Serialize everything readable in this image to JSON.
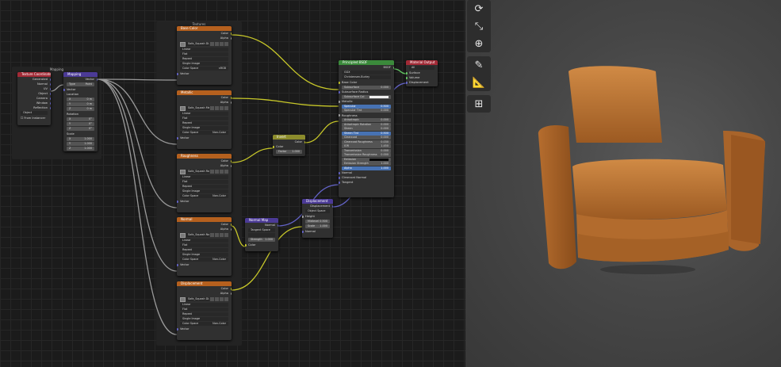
{
  "editor": {
    "frames": {
      "textures": "Textures",
      "mapping": "Mapping"
    },
    "texcoord": {
      "title": "Texture Coordinate",
      "outputs": [
        "Generated",
        "Normal",
        "UV",
        "Object",
        "Camera",
        "Window",
        "Reflection"
      ],
      "object_label": "Object",
      "from_instancer": "From Instancer"
    },
    "mapping": {
      "title": "Mapping",
      "output": "Vector",
      "type_label": "Type",
      "type_value": "Point",
      "vector": "Vector",
      "location": "Location",
      "rotation": "Rotation",
      "scale": "Scale",
      "axes": [
        "X",
        "Y",
        "Z"
      ],
      "loc_values": [
        "0 m",
        "0 m",
        "0 m"
      ],
      "rot_values": [
        "0°",
        "0°",
        "0°"
      ],
      "scale_values": [
        "1.000",
        "1.000",
        "1.000"
      ]
    },
    "image_nodes": [
      {
        "title": "Base Color",
        "image": "Sofa_Squash Di...",
        "interp": "Linear",
        "proj": "Flat",
        "ext": "Repeat",
        "source": "Single Image",
        "cs_label": "Color Space",
        "cs_value": "sRGB"
      },
      {
        "title": "Metallic",
        "image": "Sofa_Squash Me...",
        "interp": "Linear",
        "proj": "Flat",
        "ext": "Repeat",
        "source": "Single Image",
        "cs_label": "Color Space",
        "cs_value": "Non-Color"
      },
      {
        "title": "Roughness",
        "image": "Sofa_Squash Ro...",
        "interp": "Linear",
        "proj": "Flat",
        "ext": "Repeat",
        "source": "Single Image",
        "cs_label": "Color Space",
        "cs_value": "Non-Color"
      },
      {
        "title": "Normal",
        "image": "Sofa_Squash No...",
        "interp": "Linear",
        "proj": "Flat",
        "ext": "Repeat",
        "source": "Single Image",
        "cs_label": "Color Space",
        "cs_value": "Non-Color"
      },
      {
        "title": "Displacement",
        "image": "Sofa_Squash Di...",
        "interp": "Linear",
        "proj": "Flat",
        "ext": "Repeat",
        "source": "Single Image",
        "cs_label": "Color Space",
        "cs_value": "Non-Color"
      }
    ],
    "image_sockets": {
      "color": "Color",
      "alpha": "Alpha",
      "vector": "Vector"
    },
    "invert": {
      "title": "Invert",
      "output": "Color",
      "fac_label": "Factor",
      "fac_value": "1.000",
      "input": "Color"
    },
    "normalmap": {
      "title": "Normal Map",
      "output": "Normal",
      "space": "Tangent Space",
      "uv": "",
      "strength_label": "Strength",
      "strength_value": "1.000",
      "input": "Color"
    },
    "displacement": {
      "title": "Displacement",
      "output": "Displacement",
      "space": "Object Space",
      "height": "Height",
      "mid_label": "Midlevel",
      "mid_value": "0.500",
      "scale_label": "Scale",
      "scale_value": "1.000",
      "normal": "Normal"
    },
    "bsdf": {
      "title": "Principled BSDF",
      "output": "BSDF",
      "dist": "GGX",
      "sss_method": "Christensen-Burley",
      "rows": [
        {
          "label": "Base Color",
          "value": "",
          "kind": "socket"
        },
        {
          "label": "Subsurface",
          "value": "0.000",
          "kind": "field"
        },
        {
          "label": "Subsurface Radius",
          "value": "",
          "kind": "socket"
        },
        {
          "label": "Subsurface Col",
          "value": "",
          "kind": "color"
        },
        {
          "label": "Metallic",
          "value": "",
          "kind": "socket"
        },
        {
          "label": "Specular",
          "value": "0.500",
          "kind": "blue"
        },
        {
          "label": "Specular Tint",
          "value": "0.000",
          "kind": "field"
        },
        {
          "label": "Roughness",
          "value": "",
          "kind": "socket"
        },
        {
          "label": "Anisotropic",
          "value": "0.000",
          "kind": "field"
        },
        {
          "label": "Anisotropic Rotation",
          "value": "0.000",
          "kind": "field"
        },
        {
          "label": "Sheen",
          "value": "0.000",
          "kind": "field"
        },
        {
          "label": "Sheen Tint",
          "value": "0.500",
          "kind": "blue"
        },
        {
          "label": "Clearcoat",
          "value": "0.000",
          "kind": "field"
        },
        {
          "label": "Clearcoat Roughness",
          "value": "0.030",
          "kind": "field"
        },
        {
          "label": "IOR",
          "value": "1.450",
          "kind": "field"
        },
        {
          "label": "Transmission",
          "value": "0.000",
          "kind": "field"
        },
        {
          "label": "Transmission Roughness",
          "value": "0.000",
          "kind": "field"
        },
        {
          "label": "Emission",
          "value": "",
          "kind": "dark"
        },
        {
          "label": "Emission Strength",
          "value": "1.000",
          "kind": "field"
        },
        {
          "label": "Alpha",
          "value": "1.000",
          "kind": "blue"
        },
        {
          "label": "Normal",
          "value": "",
          "kind": "socket"
        },
        {
          "label": "Clearcoat Normal",
          "value": "",
          "kind": "socket"
        },
        {
          "label": "Tangent",
          "value": "",
          "kind": "socket"
        }
      ]
    },
    "output": {
      "title": "Material Output",
      "target": "All",
      "inputs": [
        "Surface",
        "Volume",
        "Displacement"
      ]
    }
  },
  "viewport": {
    "tools": [
      {
        "name": "rotate-icon",
        "glyph": "⟳"
      },
      {
        "name": "scale-icon",
        "glyph": "⤡"
      },
      {
        "name": "transform-icon",
        "glyph": "⊕"
      },
      {
        "name": "annotate-icon",
        "glyph": "✎"
      },
      {
        "name": "measure-icon",
        "glyph": "📐"
      },
      {
        "name": "add-cube-icon",
        "glyph": "⊞"
      }
    ],
    "chair_color": "#c07a35"
  }
}
